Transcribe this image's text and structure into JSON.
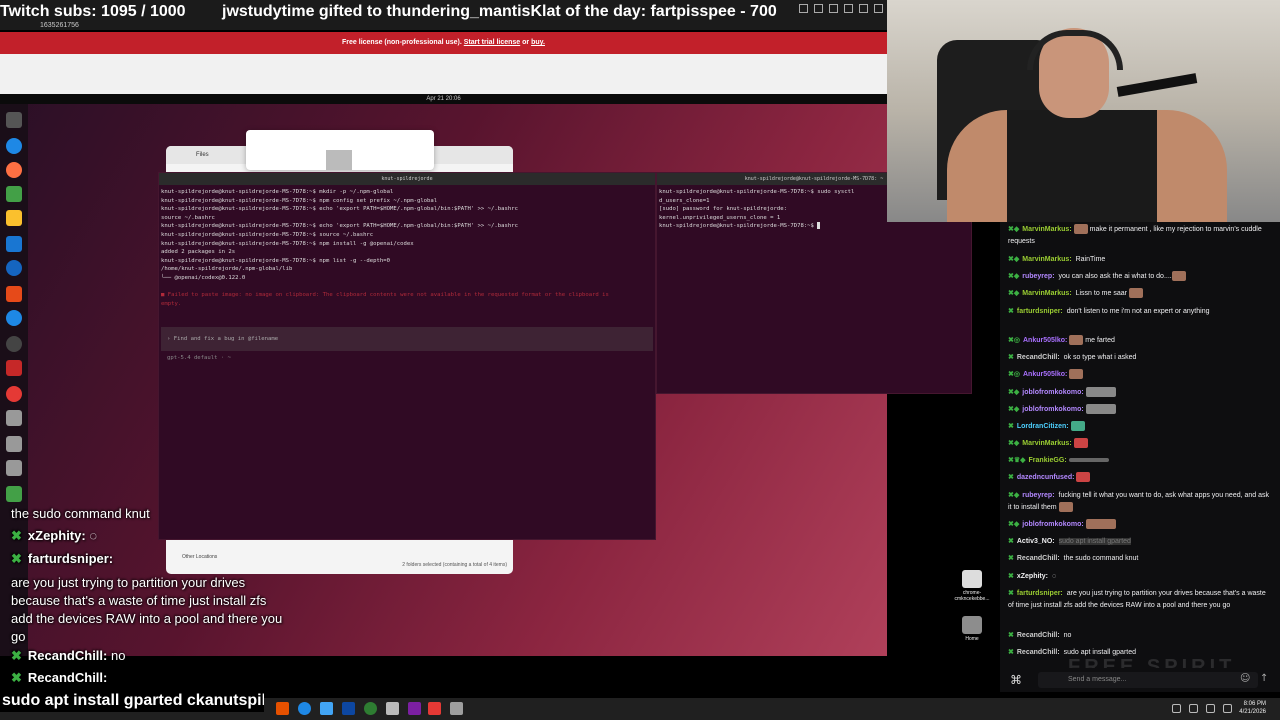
{
  "subbar": {
    "subs": "Twitch subs: 1095 / 1000",
    "gift": "jwstudytime gifted to thundering_mantisKlat of the day: fartpisspee - 700"
  },
  "vm_bar": {
    "id": "1635261756"
  },
  "license": {
    "prefix": "Free license (non-professional use).",
    "trial_link": "Start trial license",
    "or": "or",
    "buy_link": "buy."
  },
  "gnome": {
    "date": "Apr 21 20:06"
  },
  "files_window": {
    "title": "Files",
    "other_locations": "Other Locations",
    "selection": "2 folders selected (containing a total of 4 items)"
  },
  "terminal1": {
    "title": "knut-spildrejorde",
    "lines": [
      "knut-spildrejorde@knut-spildrejorde-MS-7D78:~$ mkdir -p ~/.npm-global",
      "knut-spildrejorde@knut-spildrejorde-MS-7D78:~$ npm config set prefix ~/.npm-global",
      "knut-spildrejorde@knut-spildrejorde-MS-7D78:~$ echo 'export PATH=$HOME/.npm-global/bin:$PATH' >> ~/.bashrc",
      "source ~/.bashrc",
      "knut-spildrejorde@knut-spildrejorde-MS-7D78:~$ echo 'export PATH=$HOME/.npm-global/bin:$PATH' >> ~/.bashrc",
      "knut-spildrejorde@knut-spildrejorde-MS-7D78:~$ source ~/.bashrc",
      "knut-spildrejorde@knut-spildrejorde-MS-7D78:~$ npm install -g @openai/codex",
      "",
      "added 2 packages in 2s",
      "knut-spildrejorde@knut-spildrejorde-MS-7D78:~$ npm list -g --depth=0",
      "/home/knut-spildrejorde/.npm-global/lib",
      "└── @openai/codex@0.122.0"
    ],
    "error": "■ Failed to paste image: no image on clipboard: The clipboard contents were not available in the requested format or the clipboard is empty.",
    "prompt": "› Find and fix a bug in @filename",
    "model": "gpt-5.4 default · ~"
  },
  "terminal2": {
    "title": "knut-spildrejorde@knut-spildrejorde-MS-7D78: ~",
    "lines": [
      "knut-spildrejorde@knut-spildrejorde-MS-7D78:~$ sudo sysctl",
      "d_users_clone=1",
      "[sudo] password for knut-spildrejorde:",
      "kernel.unprivileged_userns_clone = 1",
      "knut-spildrejorde@knut-spildrejorde-MS-7D78:~$ "
    ]
  },
  "desktop_icons": [
    {
      "label": "chrome-cmkncekebbe...",
      "icon": "chrome-app-icon"
    },
    {
      "label": "Home",
      "icon": "home-folder-icon"
    }
  ],
  "chat": {
    "messages": [
      {
        "name": "MarvinMarkus:",
        "color": "#9acd32",
        "text": "make it permanent , like my rejection to marvin's cuddle requests"
      },
      {
        "name": "MarvinMarkus:",
        "color": "#9acd32",
        "text": "RainTime"
      },
      {
        "name": "rubeyrep:",
        "color": "#b388ff",
        "text": "you can also ask the ai what to do...."
      },
      {
        "name": "MarvinMarkus:",
        "color": "#9acd32",
        "text": "Lissn to me saar"
      },
      {
        "name": "farturdsniper:",
        "color": "#9acd32",
        "text": "don't listen to me i'm not an expert or anything"
      },
      {
        "name": "Ankur505lko:",
        "color": "#a970ff",
        "text": "me farted"
      },
      {
        "name": "RecandChill:",
        "color": "#cccccc",
        "text": "ok so type what i asked"
      },
      {
        "name": "Ankur505lko:",
        "color": "#a970ff",
        "text": ""
      },
      {
        "name": "joblofromkokomo:",
        "color": "#b388ff",
        "text": ""
      },
      {
        "name": "joblofromkokomo:",
        "color": "#b388ff",
        "text": ""
      },
      {
        "name": "LordranCitizen:",
        "color": "#4dd0ff",
        "text": ""
      },
      {
        "name": "MarvinMarkus:",
        "color": "#9acd32",
        "text": ""
      },
      {
        "name": "FrankieGG:",
        "color": "#9acd32",
        "text": ""
      },
      {
        "name": "dazedncunfused:",
        "color": "#b388ff",
        "text": ""
      },
      {
        "name": "rubeyrep:",
        "color": "#b388ff",
        "text": "fucking tell it what you want to do, ask what apps you need, and ask it to install them"
      },
      {
        "name": "joblofromkokomo:",
        "color": "#b388ff",
        "text": ""
      },
      {
        "name": "Activ3_NO:",
        "color": "#efeff1",
        "text": "sudo apt install gparted"
      },
      {
        "name": "RecandChill:",
        "color": "#cccccc",
        "text": "the sudo command knut"
      },
      {
        "name": "xZephity:",
        "color": "#efeff1",
        "text": ""
      },
      {
        "name": "farturdsniper:",
        "color": "#9acd32",
        "text": "are you just trying to partition your drives because that's a waste of time just install zfs add the devices RAW into a pool and there you go"
      },
      {
        "name": "RecandChill:",
        "color": "#cccccc",
        "text": "no"
      },
      {
        "name": "RecandChill:",
        "color": "#cccccc",
        "text": "sudo apt install gparted"
      }
    ],
    "input_placeholder": "Send a message...",
    "watermark": "FREE SPIRIT"
  },
  "overlay": {
    "line1": "the sudo command knut",
    "user1": "xZephity:",
    "user2": "farturdsniper:",
    "text2": "are you just trying to partition your drives because that's a waste of time just install zfs add the devices RAW into a pool and there you go",
    "user3": "RecandChill:",
    "text3": "no",
    "user4": "RecandChill:"
  },
  "ticker": {
    "text": "sudo apt install gparted ckanutspild"
  },
  "taskbar": {
    "time": "8:06 PM",
    "date": "4/21/2026"
  }
}
